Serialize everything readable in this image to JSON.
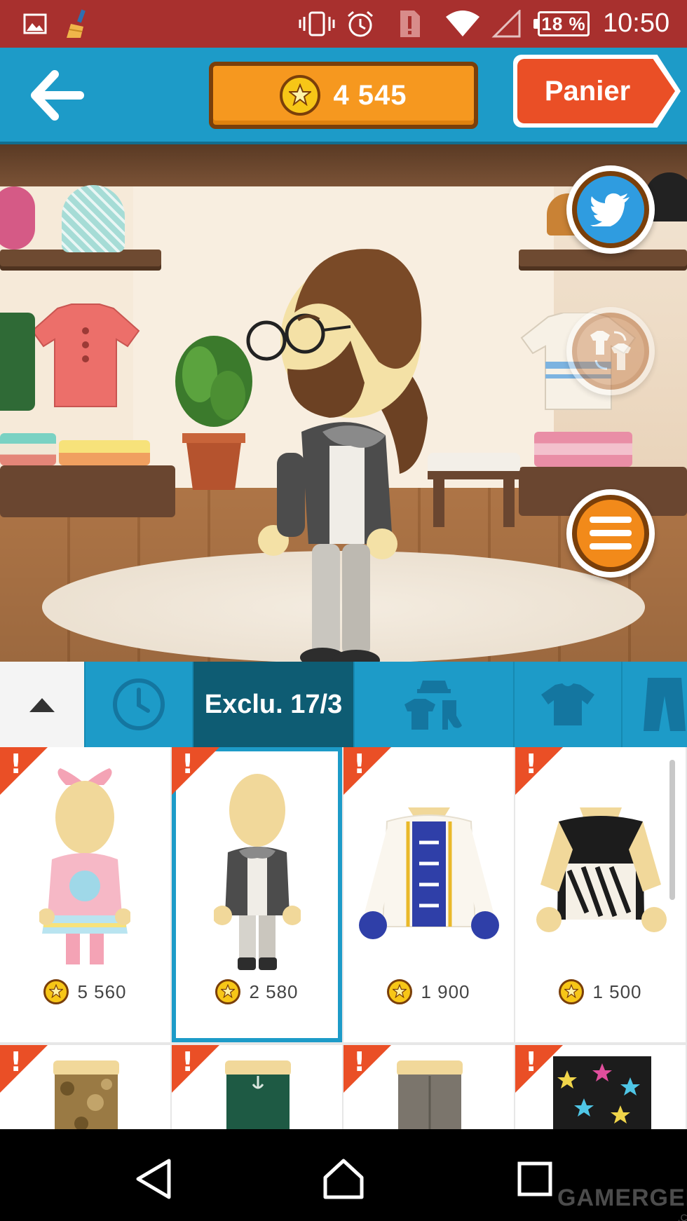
{
  "status_bar": {
    "battery": "18 %",
    "time": "10:50",
    "icons": [
      "gallery-icon",
      "cleaner-icon",
      "vibrate-icon",
      "alarm-icon",
      "alert-icon",
      "wifi-icon",
      "signal-icon"
    ]
  },
  "header": {
    "coins": "4 545",
    "cart_label": "Panier"
  },
  "scene": {
    "buttons": [
      "twitter-icon",
      "outfit-swap-icon",
      "menu-icon"
    ]
  },
  "tabs": {
    "active_label": "Exclu. 17/3",
    "icons": [
      "collapse-icon",
      "clock-icon",
      "outfit-set-icon",
      "tshirt-icon",
      "pants-icon"
    ]
  },
  "items": [
    {
      "price": "5 560",
      "new": "!"
    },
    {
      "price": "2 580",
      "new": "!",
      "selected": true
    },
    {
      "price": "1 900",
      "new": "!"
    },
    {
      "price": "1 500",
      "new": "!"
    },
    {
      "new": "!"
    },
    {
      "new": "!"
    },
    {
      "new": "!"
    },
    {
      "new": "!"
    }
  ],
  "watermark": {
    "text": "GAMERGEN",
    "sub": ".COM"
  },
  "colors": {
    "status_bar": "#a8302e",
    "header": "#1d9bc8",
    "coin_button": "#f6981f",
    "cart_button": "#ea4f26",
    "active_tab": "#0e5c73"
  }
}
